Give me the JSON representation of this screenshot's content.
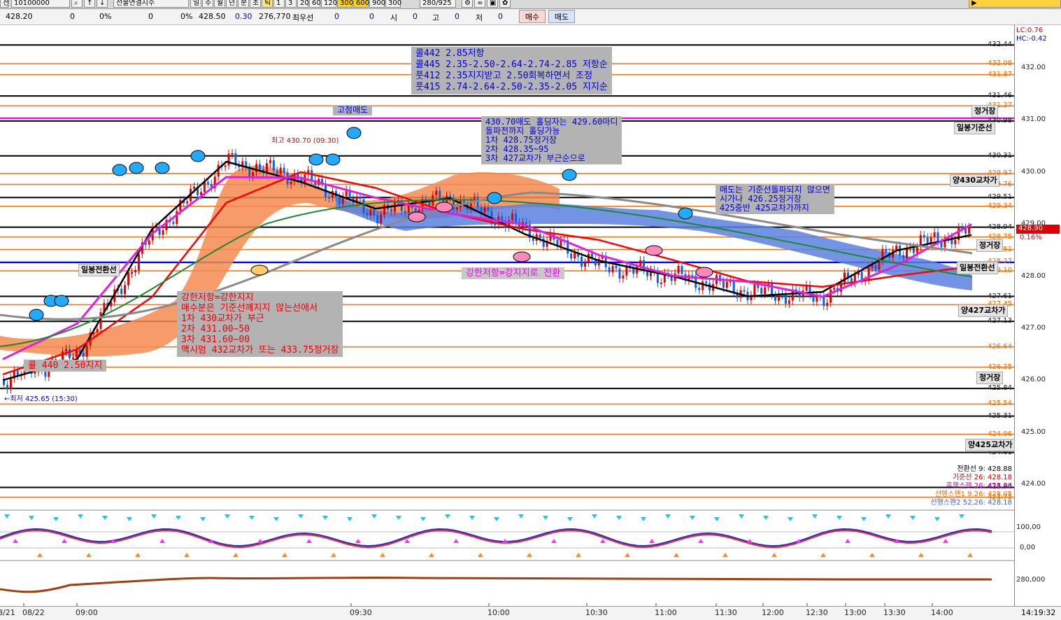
{
  "toolbar": {
    "code": "10100000",
    "product": "선물연결지수",
    "period_buttons": [
      "일",
      "주",
      "월",
      "년",
      "분",
      "초",
      "틱"
    ],
    "interval_buttons": [
      "1",
      "3",
      "20",
      "60",
      "120",
      "300",
      "600",
      "900",
      "300"
    ],
    "count": "280",
    "total": "925"
  },
  "infobar": {
    "price": "428.20",
    "v1": "0",
    "p1": "0%",
    "v2": "0",
    "p2": "0%",
    "last": "428.50",
    "change": "0.30",
    "volume": "276,770",
    "label_best": "최우선",
    "best_v1": "0",
    "best_v2": "0",
    "label_open": "시",
    "open_v": "0",
    "label_high": "고",
    "high_v": "0",
    "label_low": "저",
    "low_v": "0",
    "buy_button": "매수",
    "sell_button": "매도"
  },
  "corner": {
    "lc": "LC:0.76",
    "hc": "HC:-0.42"
  },
  "price_panel": {
    "current_price": "428.90",
    "current_pct": "0.16%",
    "y_ticks": [
      "432.00",
      "431.00",
      "430.00",
      "429.00",
      "428.00",
      "427.00",
      "426.00",
      "425.00",
      "424.00"
    ],
    "level_labels": [
      {
        "text": "432.44",
        "color": "black"
      },
      {
        "text": "432.08",
        "color": "orange"
      },
      {
        "text": "431.87",
        "color": "orange"
      },
      {
        "text": "431.46",
        "color": "black"
      },
      {
        "text": "431.27",
        "color": "orange"
      },
      {
        "text": "430.98",
        "color": "black"
      },
      {
        "text": "430.31",
        "color": "black"
      },
      {
        "text": "429.97",
        "color": "orange"
      },
      {
        "text": "429.76",
        "color": "orange"
      },
      {
        "text": "429.51",
        "color": "black"
      },
      {
        "text": "429.34",
        "color": "orange"
      },
      {
        "text": "428.94",
        "color": "black"
      },
      {
        "text": "428.75",
        "color": "orange"
      },
      {
        "text": "428.51",
        "color": "orange"
      },
      {
        "text": "428.27",
        "color": "orange"
      },
      {
        "text": "428.10",
        "color": "orange"
      },
      {
        "text": "427.61",
        "color": "black"
      },
      {
        "text": "427.45",
        "color": "orange"
      },
      {
        "text": "427.13",
        "color": "black"
      },
      {
        "text": "426.64",
        "color": "orange"
      },
      {
        "text": "426.25",
        "color": "orange"
      },
      {
        "text": "425.84",
        "color": "black"
      },
      {
        "text": "425.54",
        "color": "orange"
      },
      {
        "text": "425.31",
        "color": "black"
      },
      {
        "text": "424.96",
        "color": "orange"
      },
      {
        "text": "424.61",
        "color": "black"
      },
      {
        "text": "423.94",
        "color": "black"
      },
      {
        "text": "423.75",
        "color": "orange"
      }
    ],
    "high_label": "최고 430.70 (09:30)",
    "low_label": "←최저 425.65 (15:30)",
    "indicator_legend": [
      {
        "text": "전환선 9: 428.88",
        "color": "#000000"
      },
      {
        "text": "기준선 26: 428.18",
        "color": "#cc0000"
      },
      {
        "text": "후행스팬 26: 428.90",
        "color": "#cc00cc"
      },
      {
        "text": "선행스팬1 9,26: 428.05",
        "color": "#ee6a00"
      },
      {
        "text": "선행스팬2 52,26: 428.18",
        "color": "#4060cc"
      }
    ],
    "level_tags": [
      "정거장",
      "일봉기준선",
      "양430교차가",
      "정거장",
      "일봉전환선",
      "양427교차가",
      "정거장",
      "양425교차가"
    ],
    "left_tags": [
      "일봉전환선"
    ]
  },
  "annotations": {
    "box1": "콜442 2.85저항\n콜445 2.35-2.50-2.64-2.74-2.85 저항순\n풋412 2.35지지받고 2.50회복하면서 조정\n풋415 2.74-2.64-2.50-2.35-2.05 지지순",
    "top_sell": "고점매도",
    "box2": "430.70매도 홀딩자는 429.60마디\n돌파전까지 홀딩가능\n1차 428.75정거장\n2차 428.35~95\n3차 427교차가 부근순으로",
    "box3": "매도는 기준선돌파되지 않으면\n시가나 426.25정거장\n425중반 425교차가까지",
    "box4": "강한저항=강한지지\n매수분은 기준선께지지 않는선에서\n1차 430교차가 부근\n2차 431.00~50\n3차 431.60~00\n맥시멈 432교차가 또는 433.75정거장",
    "call_support": "콜 440 2.50지지",
    "switch_note": "강한저항=강지지로 전환"
  },
  "osc_panel": {
    "y_ticks": [
      "100,00",
      "0,00"
    ]
  },
  "volume_panel": {
    "y_ticks": [
      "280,000"
    ]
  },
  "x_axis": {
    "ticks": [
      "8/21",
      "08/22",
      "09:00",
      "09:30",
      "10:00",
      "10:30",
      "11:00",
      "11:30",
      "12:00",
      "12:30",
      "13:00",
      "13:30",
      "14:00"
    ],
    "clock": "14:19:32"
  },
  "chart_data": {
    "type": "candlestick",
    "title": "",
    "ylim": [
      423.5,
      432.7
    ],
    "x": [
      "8/21",
      "08/22",
      "09:00",
      "09:30",
      "10:00",
      "10:30",
      "11:00",
      "11:30",
      "12:00",
      "12:30",
      "13:00",
      "13:30",
      "14:00"
    ],
    "series": [
      {
        "name": "전환선 9",
        "values": [
          426.0,
          426.5,
          428.8,
          430.2,
          429.9,
          429.2,
          429.5,
          428.9,
          428.2,
          428.0,
          427.7,
          427.6,
          428.5,
          428.88
        ]
      },
      {
        "name": "기준선 26",
        "values": [
          426.2,
          426.6,
          427.5,
          429.5,
          430.0,
          429.6,
          429.3,
          428.9,
          428.6,
          428.4,
          427.9,
          427.7,
          428.1,
          428.18
        ]
      },
      {
        "name": "후행스팬 26",
        "values": [
          426.5,
          427.0,
          428.8,
          430.0,
          429.8,
          429.5,
          429.3,
          428.9,
          428.4,
          428.1,
          427.8,
          427.6,
          428.3,
          428.9
        ]
      }
    ],
    "high": {
      "value": 430.7,
      "time": "09:30"
    },
    "low": {
      "value": 425.65,
      "time": "15:30"
    },
    "last": 428.9
  }
}
